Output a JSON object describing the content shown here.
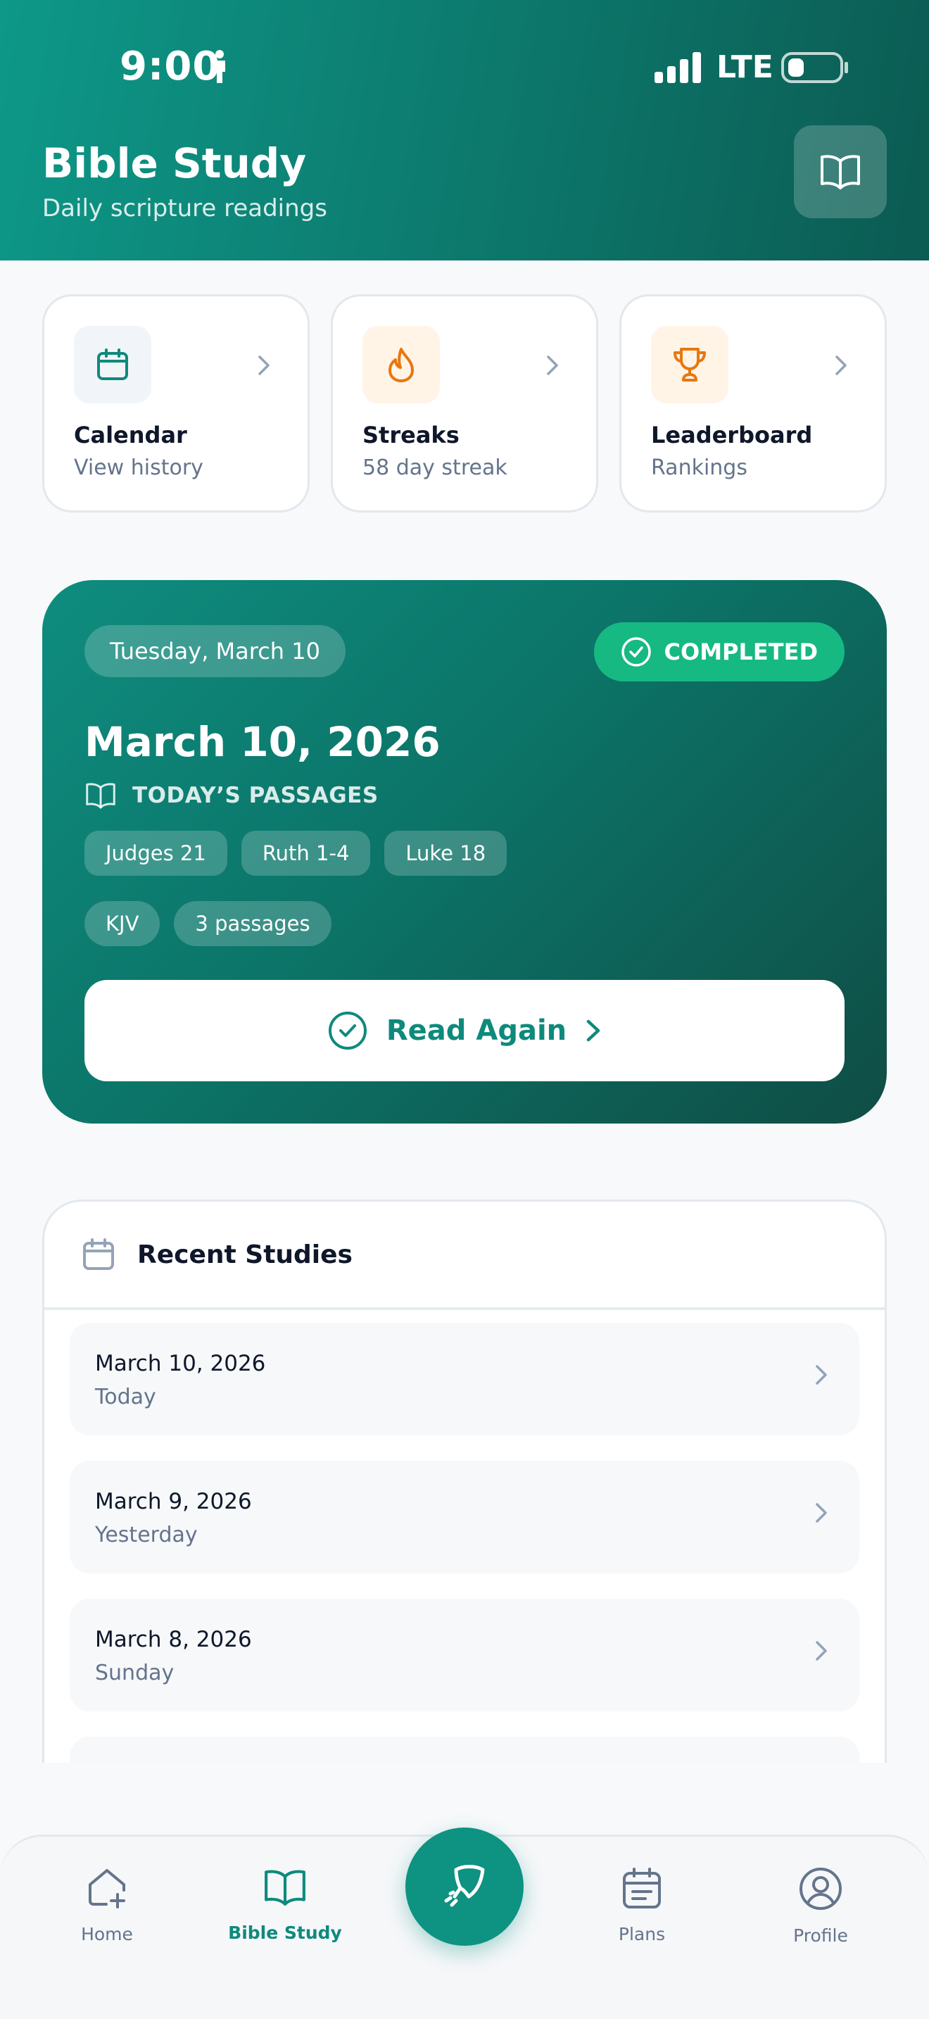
{
  "status_bar": {
    "time": "9:00",
    "network": "LTE"
  },
  "header": {
    "title": "Bible Study",
    "subtitle": "Daily scripture readings",
    "icon": "book-open-icon"
  },
  "tiles": [
    {
      "title": "Calendar",
      "subtitle": "View history",
      "icon": "calendar-icon",
      "icon_bg": "#f1f5f9",
      "icon_color": "#0e8a7c"
    },
    {
      "title": "Streaks",
      "subtitle": "58 day streak",
      "icon": "flame-icon",
      "icon_bg": "#fff4e6",
      "icon_color": "#e8770f"
    },
    {
      "title": "Leaderboard",
      "subtitle": "Rankings",
      "icon": "trophy-icon",
      "icon_bg": "#fff4e6",
      "icon_color": "#e8770f"
    }
  ],
  "today": {
    "day_label": "Tuesday, March 10",
    "status": "COMPLETED",
    "date": "March 10, 2026",
    "passages_label": "TODAY’S PASSAGES",
    "passages": [
      "Judges 21",
      "Ruth 1-4",
      "Luke 18"
    ],
    "version": "KJV",
    "passage_count": "3 passages",
    "action_label": "Read Again"
  },
  "recent": {
    "title": "Recent Studies",
    "items": [
      {
        "date": "March 10, 2026",
        "label": "Today"
      },
      {
        "date": "March 9, 2026",
        "label": "Yesterday"
      },
      {
        "date": "March 8, 2026",
        "label": "Sunday"
      }
    ]
  },
  "nav": {
    "home": "Home",
    "bible_study": "Bible Study",
    "plans": "Plans",
    "profile": "Profile",
    "active": "bible_study"
  },
  "colors": {
    "accent": "#0e8a7c",
    "completed": "#16b981",
    "streak": "#e8770f"
  }
}
